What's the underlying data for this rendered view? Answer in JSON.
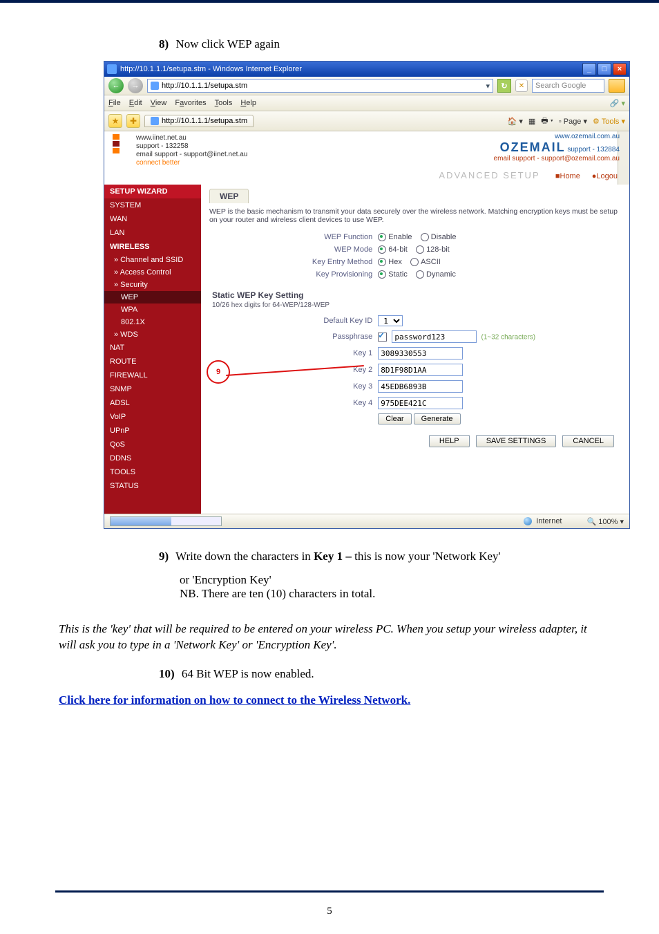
{
  "step8": {
    "num": "8)",
    "text": "Now click WEP again"
  },
  "step9": {
    "num": "9)",
    "line1_a": "Write down the characters in ",
    "line1_bold": "Key 1 – ",
    "line1_b": "this is now your 'Network Key'",
    "line2": "or 'Encryption Key'",
    "line3": "NB. There are ten (10) characters in total."
  },
  "body_para": "This is the 'key' that will be required to be entered on your wireless PC.  When you setup your wireless adapter, it will ask you to type in a 'Network Key' or 'Encryption Key'.",
  "step10": {
    "num": "10)",
    "text": " 64 Bit WEP is now enabled."
  },
  "link_line": "Click here for information on how to connect to the Wireless Network.",
  "page_number": "5",
  "ie": {
    "title": "http://10.1.1.1/setupa.stm - Windows Internet Explorer",
    "address": "http://10.1.1.1/setupa.stm",
    "tab_label": "http://10.1.1.1/setupa.stm",
    "search_placeholder": "Search Google",
    "menu": {
      "file": "File",
      "edit": "Edit",
      "view": "View",
      "favorites": "Favorites",
      "tools": "Tools",
      "help": "Help"
    },
    "toolbar_right": {
      "page": "Page",
      "tools": "Tools"
    },
    "status": {
      "internet": "Internet",
      "zoom": "100%"
    }
  },
  "brand": {
    "iinet_www": "www.iinet.net.au",
    "iinet_support": "support - 132258",
    "iinet_email": "email support - support@iinet.net.au",
    "connect_better": "connect better",
    "oz_name": "OZEMAIL",
    "oz_www": "www.ozemail.com.au",
    "oz_support": "support - 132884",
    "oz_email": "email support - support@ozemail.com.au",
    "adv": "ADVANCED SETUP",
    "home": "Home",
    "logout": "Logout"
  },
  "side": {
    "setup_wizard": "SETUP WIZARD",
    "system": "SYSTEM",
    "wan": "WAN",
    "lan": "LAN",
    "wireless": "WIRELESS",
    "ch_ssid": "» Channel and SSID",
    "access": "» Access Control",
    "security": "» Security",
    "wep": "WEP",
    "wpa": "WPA",
    "x8021": "802.1X",
    "wds": "» WDS",
    "nat": "NAT",
    "route": "ROUTE",
    "firewall": "FIREWALL",
    "snmp": "SNMP",
    "adsl": "ADSL",
    "voip": "VoIP",
    "upnp": "UPnP",
    "qos": "QoS",
    "ddns": "DDNS",
    "tools": "TOOLS",
    "status": "STATUS"
  },
  "wep": {
    "tab": "WEP",
    "desc": "WEP is the basic mechanism to transmit your data securely over the wireless network. Matching encryption keys must be setup on your router and wireless client devices to use WEP.",
    "f_function": "WEP Function",
    "f_mode": "WEP Mode",
    "f_entry": "Key Entry Method",
    "f_prov": "Key Provisioning",
    "enable": "Enable",
    "disable": "Disable",
    "b64": "64-bit",
    "b128": "128-bit",
    "hex": "Hex",
    "ascii": "ASCII",
    "static": "Static",
    "dynamic": "Dynamic",
    "sec_head": "Static WEP Key Setting",
    "sub_head": "10/26 hex digits for 64-WEP/128-WEP",
    "defkey": "Default Key ID",
    "defkey_val": "1",
    "pass": "Passphrase",
    "pass_val": "password123",
    "pass_hint": "(1~32 characters)",
    "k1": "Key 1",
    "k1v": "3089330553",
    "k2": "Key 2",
    "k2v": "8D1F98D1AA",
    "k3": "Key 3",
    "k3v": "45EDB6893B",
    "k4": "Key 4",
    "k4v": "975DEE421C",
    "clear": "Clear",
    "generate": "Generate",
    "help": "HELP",
    "save": "SAVE SETTINGS",
    "cancel": "CANCEL",
    "marker": "9"
  }
}
